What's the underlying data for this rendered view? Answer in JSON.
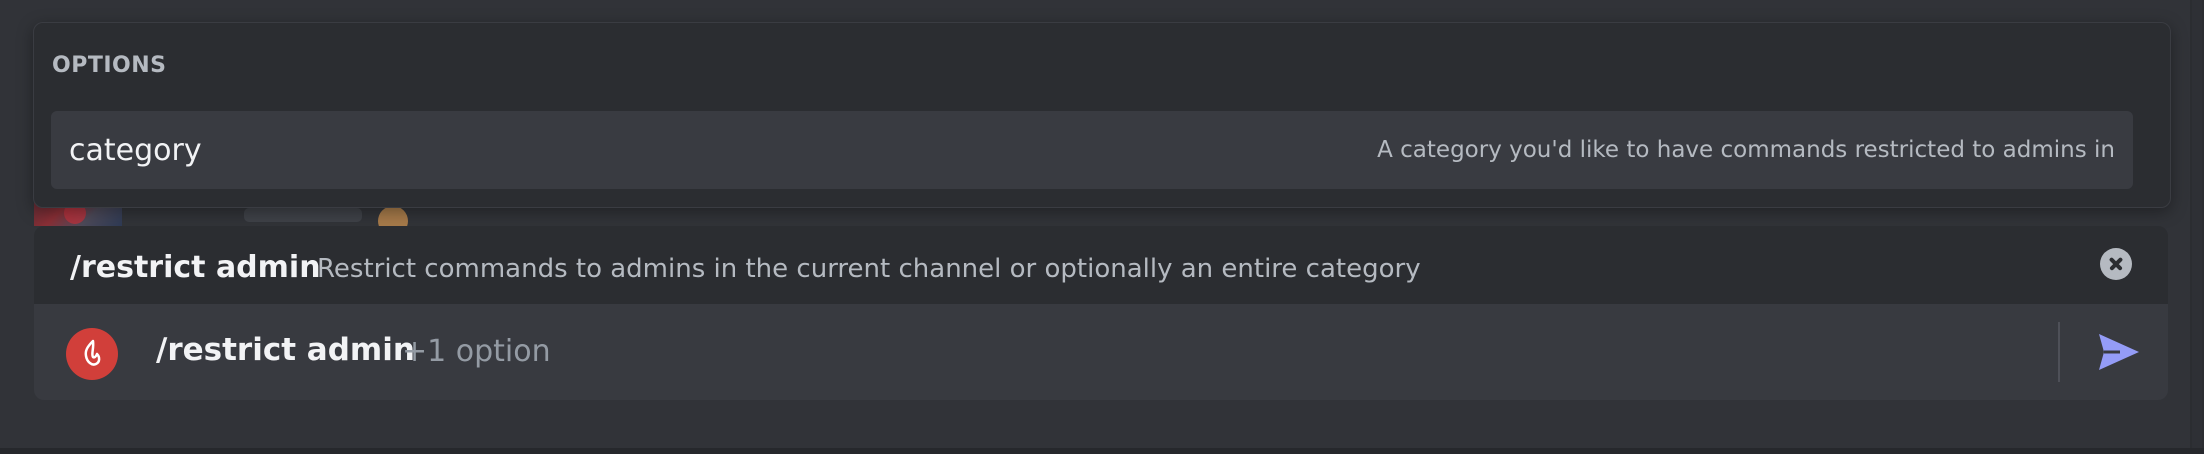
{
  "options_popup": {
    "header": "OPTIONS",
    "options": [
      {
        "name": "category",
        "description": "A category you'd like to have commands restricted to admins in"
      }
    ]
  },
  "command_info": {
    "name": "/restrict admin",
    "description": "Restrict commands to admins in the current channel or optionally an entire category"
  },
  "input": {
    "command": "/restrict admin",
    "extra": "+1 option"
  },
  "colors": {
    "background": "#313338",
    "popup": "#2b2d31",
    "option_row": "#393b41",
    "input_bar": "#383a40",
    "app_icon": "#d13f3a",
    "send_accent": "#949cf7"
  },
  "icons": {
    "app": "flame-icon",
    "close": "close-circle-icon",
    "send": "send-arrow-icon"
  }
}
